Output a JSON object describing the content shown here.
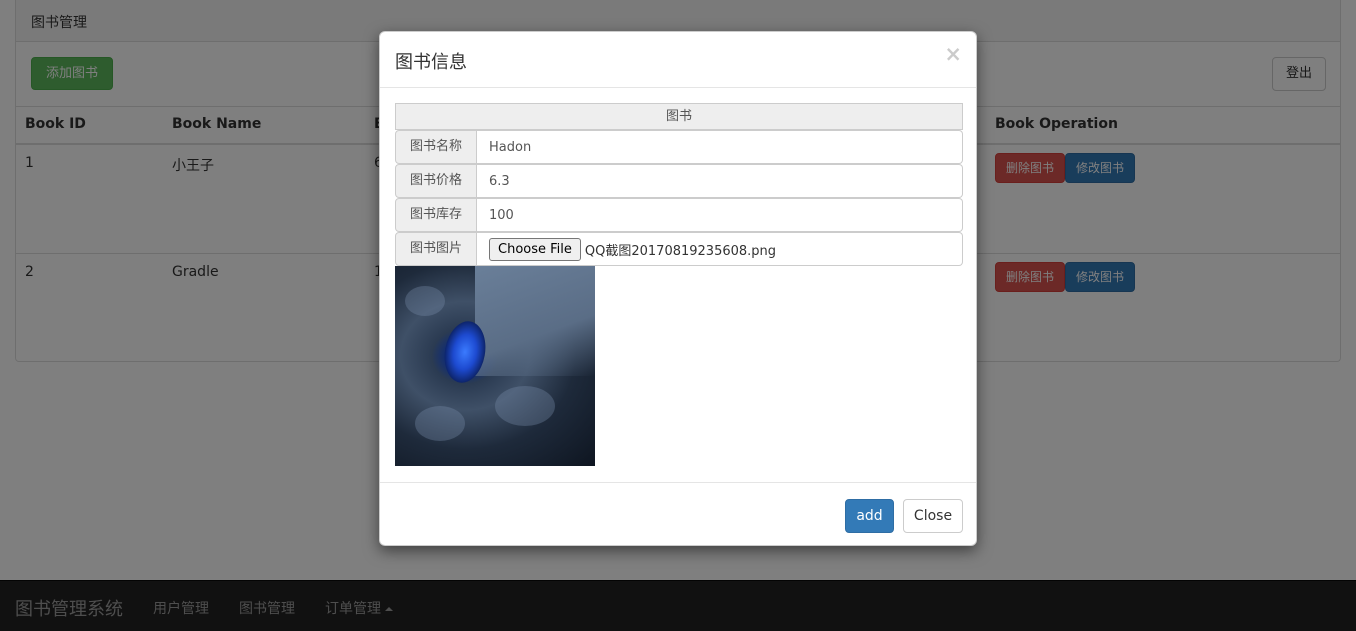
{
  "panel": {
    "heading": "图书管理",
    "add_button": "添加图书",
    "logout_button": "登出"
  },
  "table": {
    "headers": [
      "Book ID",
      "Book Name",
      "B",
      "Book Operation"
    ],
    "rows": [
      {
        "id": "1",
        "name": "小王子",
        "partial": "6",
        "delete": "删除图书",
        "edit": "修改图书"
      },
      {
        "id": "2",
        "name": "Gradle",
        "partial": "1",
        "delete": "删除图书",
        "edit": "修改图书"
      }
    ]
  },
  "navbar": {
    "brand": "图书管理系统",
    "links": [
      "用户管理",
      "图书管理",
      "订单管理"
    ]
  },
  "modal": {
    "title": "图书信息",
    "close_symbol": "×",
    "group_title": "图书",
    "fields": {
      "name_label": "图书名称",
      "name_value": "Hadon",
      "price_label": "图书价格",
      "price_value": "6.3",
      "stock_label": "图书库存",
      "stock_value": "100",
      "image_label": "图书图片",
      "choose_file": "Choose File",
      "file_name": "QQ截图20170819235608.png"
    },
    "add_button": "add",
    "close_button": "Close"
  },
  "icons": {
    "close": "close-icon",
    "dropdown": "caret-up-icon"
  },
  "colors": {
    "success": "#5cb85c",
    "danger": "#d9534f",
    "primary": "#337ab7",
    "navbar": "#222222"
  }
}
